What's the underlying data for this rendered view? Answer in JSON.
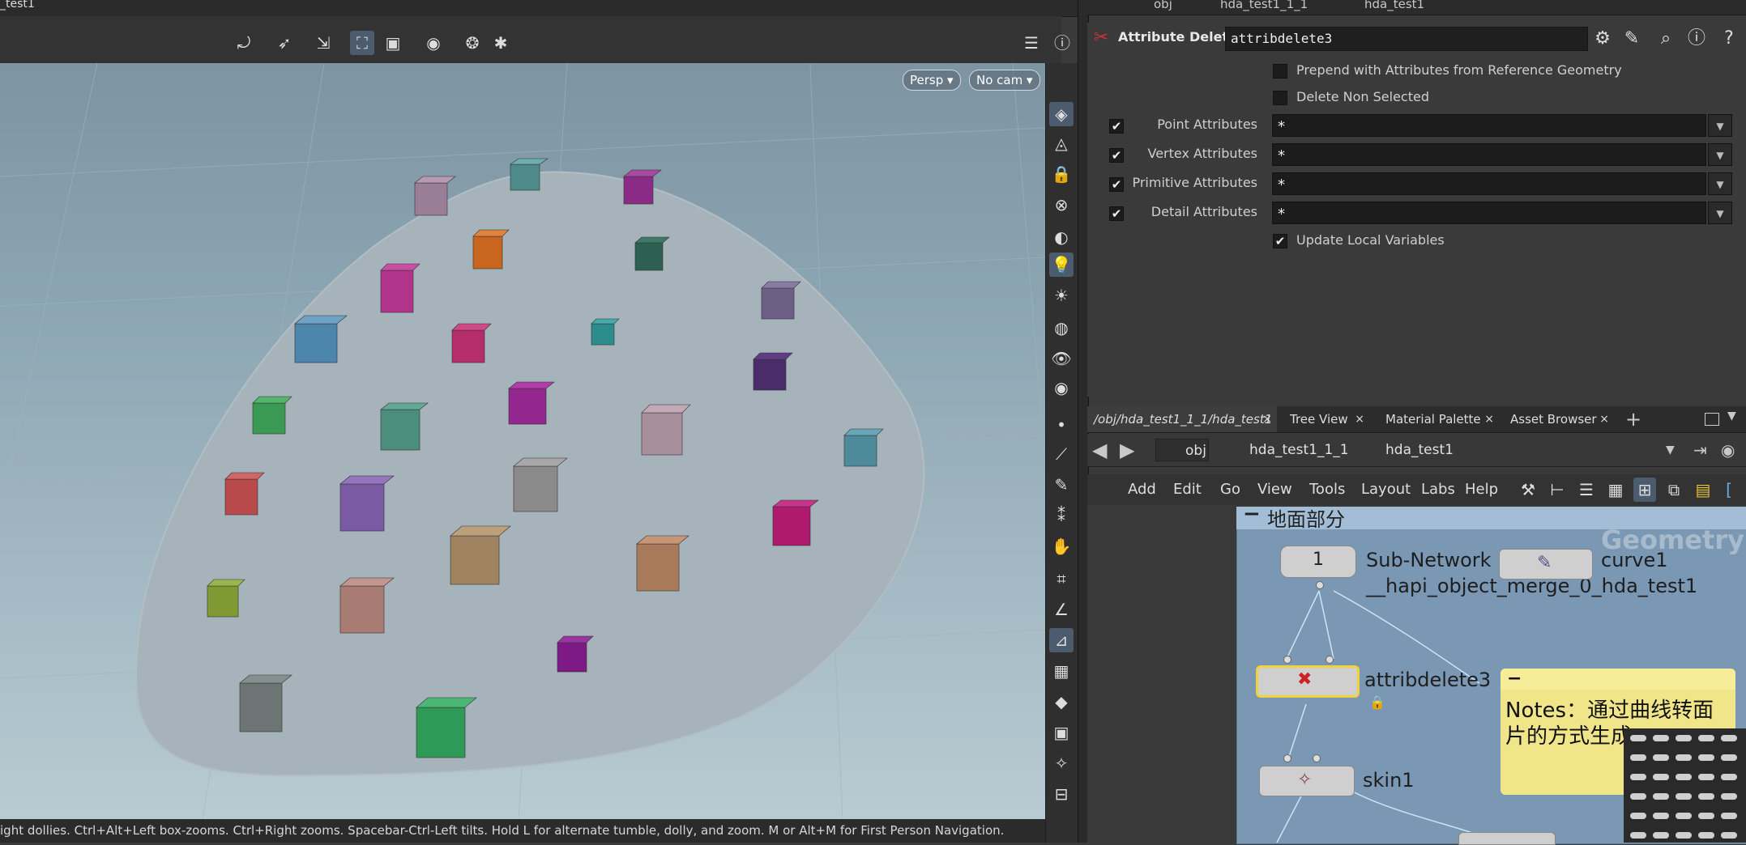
{
  "viewport": {
    "title_fragment": "_test1",
    "cam_persp": "Persp",
    "cam_name": "No cam",
    "status_text": "ight dollies. Ctrl+Alt+Left box-zooms. Ctrl+Right zooms. Spacebar-Ctrl-Left tilts. Hold L for alternate tumble, dolly, and zoom. M or Alt+M for First Person Navigation."
  },
  "param_top": {
    "path": [
      "obj",
      "hda_test1_1_1",
      "hda_test1"
    ]
  },
  "params": {
    "node_type": "Attribute Delete",
    "node_name": "attribdelete3",
    "prepend_label": "Prepend with Attributes from Reference Geometry",
    "prepend_checked": false,
    "delete_nonselected_label": "Delete Non Selected",
    "delete_nonselected_checked": false,
    "point_label": "Point Attributes",
    "point_value": "*",
    "vertex_label": "Vertex Attributes",
    "vertex_value": "*",
    "primitive_label": "Primitive Attributes",
    "primitive_value": "*",
    "detail_label": "Detail Attributes",
    "detail_value": "*",
    "update_local_label": "Update Local Variables",
    "check_mark": "✔"
  },
  "tabs": {
    "t1": "/obj/hda_test1_1_1/hda_test1",
    "t2": "Tree View",
    "t3": "Material Palette",
    "t4": "Asset Browser",
    "close": "×",
    "add": "+"
  },
  "net_path": {
    "obj": "obj",
    "hda": "hda_test1_1_1",
    "sub": "hda_test1"
  },
  "net_menu": {
    "add": "Add",
    "edit": "Edit",
    "go": "Go",
    "view": "View",
    "tools": "Tools",
    "layout": "Layout",
    "labs": "Labs",
    "help": "Help"
  },
  "network": {
    "box_title": "地面部分",
    "watermark": "Geometry",
    "subnet_input_num": "1",
    "subnet_label_1": "Sub-Network In",
    "subnet_label_2": "__hapi_object_merge_0_hda_test1",
    "curve": "curve1",
    "attribdelete": "attribdelete3",
    "skin": "skin1",
    "note": "Notes：通过曲线转面片的方式生成"
  }
}
